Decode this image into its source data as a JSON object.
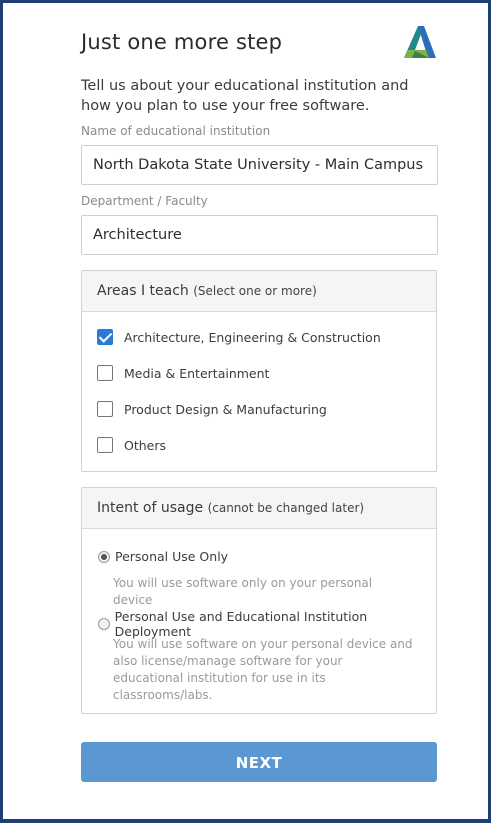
{
  "header": {
    "title": "Just one more step",
    "logo_icon": "autodesk-logo-icon"
  },
  "intro_text": "Tell us about your educational institution and how you plan to use your free software.",
  "institution": {
    "label": "Name of educational institution",
    "value": "North Dakota State University - Main Campus"
  },
  "department": {
    "label": "Department / Faculty",
    "value": "Architecture"
  },
  "areas": {
    "heading": "Areas I teach",
    "subheading": "(Select one or more)",
    "options": [
      {
        "label": "Architecture, Engineering & Construction",
        "checked": true
      },
      {
        "label": "Media & Entertainment",
        "checked": false
      },
      {
        "label": "Product Design & Manufacturing",
        "checked": false
      },
      {
        "label": "Others",
        "checked": false
      }
    ]
  },
  "intent": {
    "heading": "Intent of usage",
    "subheading": "(cannot be changed later)",
    "options": [
      {
        "label": "Personal Use Only",
        "description": "You will use software only on your personal device",
        "selected": true
      },
      {
        "label": "Personal Use and Educational Institution Deployment",
        "description": "You will use software on your personal device and also license/manage software for your educational institution for use in its classrooms/labs.",
        "selected": false
      }
    ]
  },
  "next_button": "NEXT",
  "colors": {
    "frame_border": "#1f3f74",
    "accent_blue": "#2b7bd4",
    "button_blue": "#5b97d3"
  }
}
